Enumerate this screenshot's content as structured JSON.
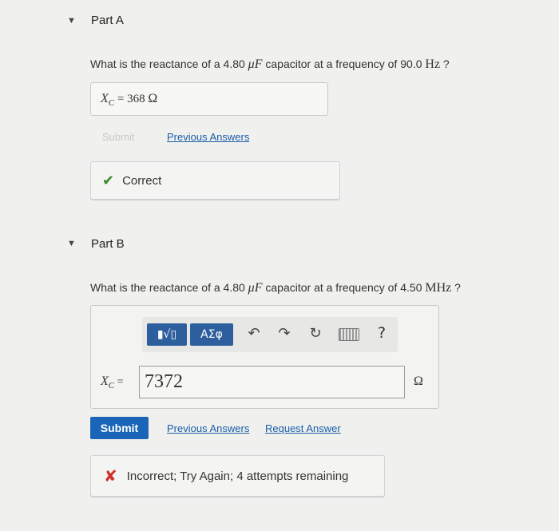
{
  "partA": {
    "header": "Part A",
    "question_prefix": "What is the reactance of a 4.80 ",
    "question_unit1": "μF",
    "question_mid": " capacitor at a frequency of 90.0 ",
    "question_unit2": "Hz",
    "question_suffix": " ?",
    "answer_var": "X",
    "answer_sub": "C",
    "answer_eq": " = 368 ",
    "answer_unit": "Ω",
    "submit_label": "Submit",
    "previous_answers": "Previous Answers",
    "feedback": "Correct"
  },
  "partB": {
    "header": "Part B",
    "question_prefix": "What is the reactance of a 4.80 ",
    "question_unit1": "μF",
    "question_mid": " capacitor at a frequency of 4.50 ",
    "question_unit2": "MHz",
    "question_suffix": " ?",
    "toolbar": {
      "templates_label": "▮√▯",
      "symbols_label": "ΑΣφ",
      "help_label": "?"
    },
    "input_var": "X",
    "input_sub": "C",
    "input_eq": " = ",
    "input_value": "7372",
    "input_unit": "Ω",
    "submit_label": "Submit",
    "previous_answers": "Previous Answers",
    "request_answer": "Request Answer",
    "feedback": "Incorrect; Try Again; 4 attempts remaining"
  },
  "colors": {
    "correct": "#3a8a2e",
    "incorrect": "#d0312d",
    "link": "#1a5ea8",
    "submit": "#1a65b8"
  },
  "icons": [
    "caret-down-icon",
    "checkmark-icon",
    "x-icon",
    "undo-icon",
    "redo-icon",
    "reset-icon",
    "keyboard-icon",
    "help-icon"
  ]
}
